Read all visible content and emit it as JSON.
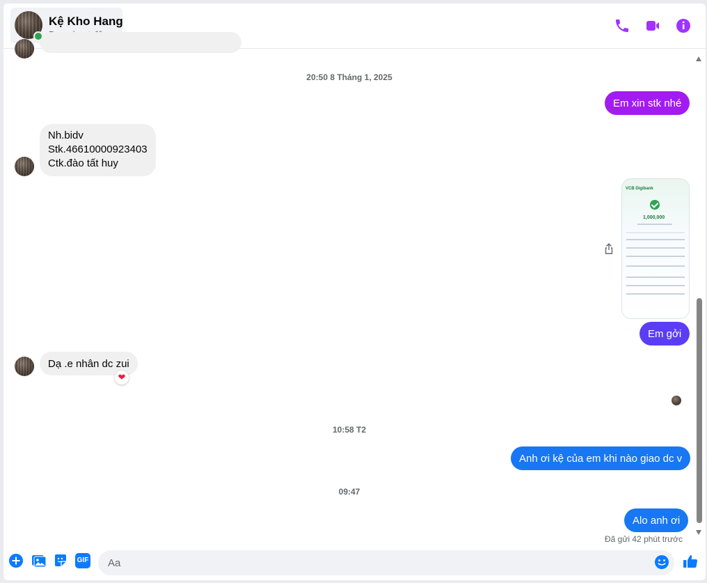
{
  "header": {
    "contact_name": "Kệ Kho Hang",
    "status": "Đang hoạt động",
    "actions": {
      "call": "phone-icon",
      "video": "video-camera-icon",
      "info": "info-icon"
    },
    "accent_color": "#a033ff"
  },
  "conversation": {
    "timestamps": [
      "20:50 8 Tháng 1, 2025",
      "10:58 T2",
      "09:47"
    ],
    "messages": [
      {
        "from": "me",
        "text": "Em xin stk nhé"
      },
      {
        "from": "contact",
        "lines": [
          "Nh.bidv",
          "Stk.46610000923403",
          "Ctk.đào tất huy"
        ]
      },
      {
        "from": "me",
        "type": "image",
        "image": {
          "brand": "VCB Digibank",
          "amount": "1,000,000"
        }
      },
      {
        "from": "me",
        "text": "Em gởi"
      },
      {
        "from": "contact",
        "text": "Dạ .e nhân dc zui",
        "reaction": "❤"
      },
      {
        "from": "me",
        "text": "Anh ơi kệ của em khi nào giao dc v"
      },
      {
        "from": "me",
        "text": "Alo anh ơi"
      }
    ],
    "sent_status": "Đã gửi 42 phút trước"
  },
  "composer": {
    "placeholder": "Aa",
    "icons": [
      "plus-circle-icon",
      "image-icon",
      "sticker-icon",
      "gif-icon",
      "emoji-icon",
      "thumbs-up-icon"
    ],
    "gif_label": "GIF"
  },
  "colors": {
    "bubble_in": "#f0f0f0",
    "bubble_purple": "#a21cf0",
    "bubble_indigo": "#5b3df5",
    "bubble_blue": "#1877f2",
    "icon_blue": "#0a7cff"
  }
}
